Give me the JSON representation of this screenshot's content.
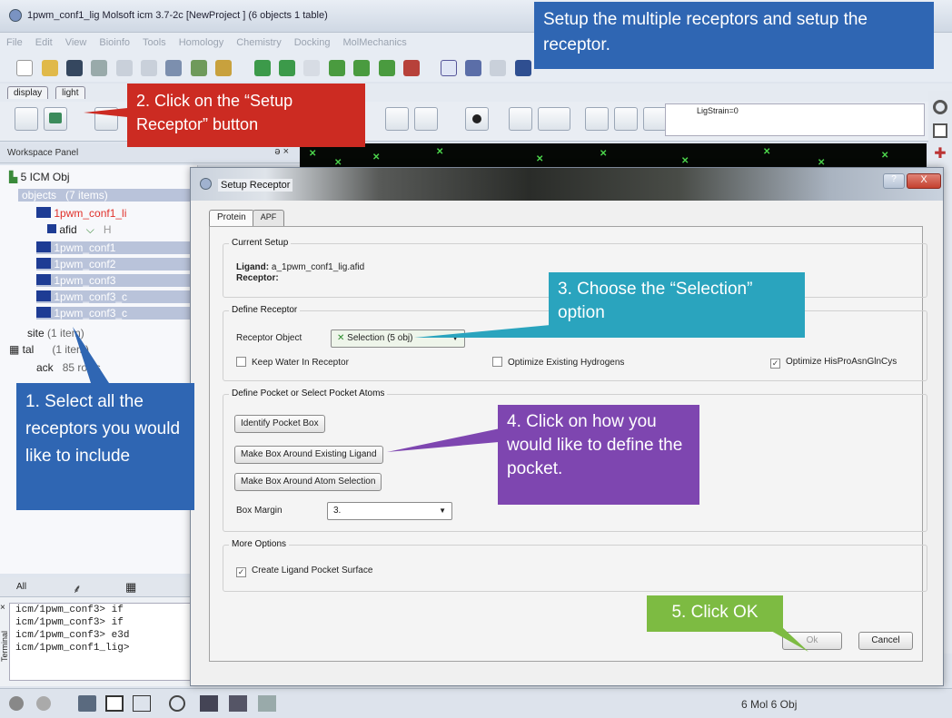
{
  "window": {
    "title": "1pwm_conf1_lig Molsoft icm 3.7-2c  [NewProject ] (6 objects 1 table)"
  },
  "menu": [
    "File",
    "Edit",
    "View",
    "Bioinfo",
    "Tools",
    "Homology",
    "Chemistry",
    "Docking",
    "MolMechanics"
  ],
  "tabs": [
    "display",
    "light"
  ],
  "ligstrain": "LigStrain=0",
  "workspace": {
    "header": "Workspace Panel",
    "controls": "ə ×",
    "root": "5 ICM Obj",
    "objects_label": "objects",
    "objects_count": "(7 items)",
    "tree": [
      {
        "label": "1pwm_conf1_li"
      },
      {
        "label": "afid",
        "extra": "H"
      },
      {
        "label": "1pwm_conf1"
      },
      {
        "label": "1pwm_conf2"
      },
      {
        "label": "1pwm_conf3"
      },
      {
        "label": "1pwm_conf3_c"
      },
      {
        "label": "1pwm_conf3_c"
      }
    ],
    "site_label": "site",
    "site_count": "(1 item)",
    "table_label": "tal",
    "table_count": "(1 item)",
    "table_child": "ack",
    "table_rows": "85 rows"
  },
  "bottom_tabs": [
    "All"
  ],
  "terminal": [
    "icm/1pwm_conf3> if",
    "icm/1pwm_conf3> if",
    "icm/1pwm_conf3> e3d",
    "icm/1pwm_conf1_lig>"
  ],
  "terminal_side": "Terminal",
  "status": "6 Mol 6 Obj",
  "dialog": {
    "title": "Setup Receptor",
    "help": "?",
    "close": "X",
    "tabs": [
      "Protein",
      "APF"
    ],
    "current_setup": {
      "title": "Current Setup",
      "ligand_label": "Ligand:",
      "ligand_value": "a_1pwm_conf1_lig.afid",
      "receptor_label": "Receptor:"
    },
    "define_receptor": {
      "title": "Define Receptor",
      "object_label": "Receptor Object",
      "object_value": "Selection (5 obj)",
      "keep_water": "Keep Water In Receptor",
      "optimize_h": "Optimize Existing Hydrogens",
      "optimize_his": "Optimize HisProAsnGlnCys",
      "optimize_his_checked": "✓"
    },
    "define_pocket": {
      "title": "Define Pocket or Select Pocket Atoms",
      "identify": "Identify Pocket Box",
      "around_ligand": "Make Box Around Existing Ligand",
      "around_atoms": "Make Box Around Atom Selection",
      "margin_label": "Box Margin",
      "margin_value": "3."
    },
    "more": {
      "title": "More Options",
      "create_surface": "Create Ligand Pocket Surface",
      "create_checked": "✓"
    },
    "ok": "Ok",
    "cancel": "Cancel"
  },
  "callouts": {
    "top": "Setup the multiple receptors and setup the receptor.",
    "step1": "1. Select all the receptors you would like to include",
    "step2": "2. Click on the “Setup Receptor” button",
    "step3": "3. Choose the “Selection” option",
    "step4": "4. Click on how you would like to define the pocket.",
    "step5": "5. Click OK"
  },
  "colors": {
    "blue": "#2f66b3",
    "red": "#cc2b22",
    "teal": "#2aa4be",
    "purple": "#7e46b0",
    "green": "#7dbb42"
  }
}
